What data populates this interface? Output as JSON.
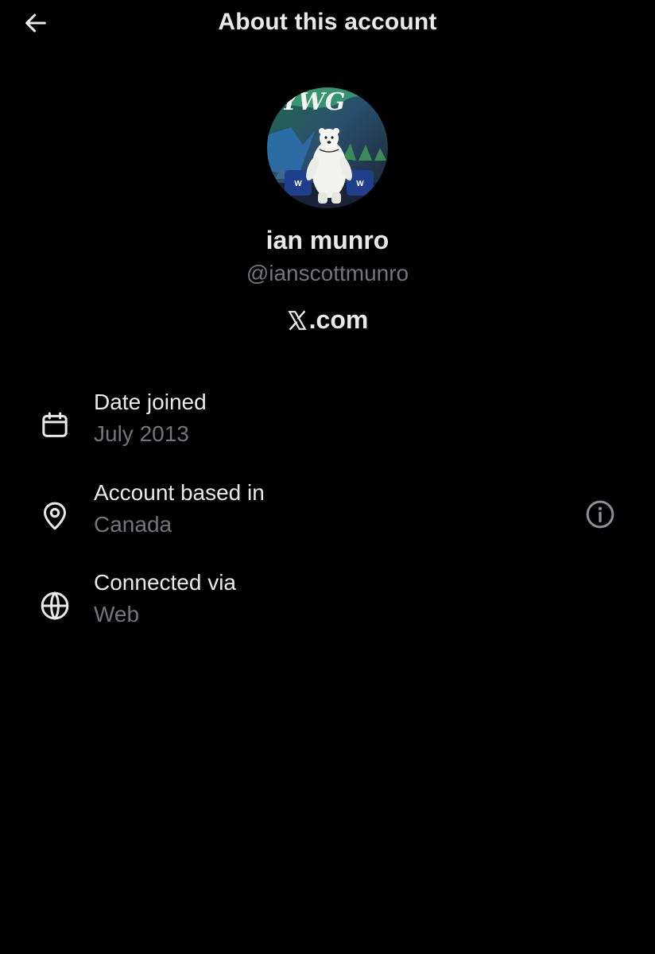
{
  "header": {
    "title": "About this account",
    "back_icon": "arrow-left-icon"
  },
  "profile": {
    "name": "ian munro",
    "handle": "@ianscottmunro",
    "platform_suffix": ".com",
    "platform_logo_icon": "x-logo-icon",
    "avatar_text": "YWG"
  },
  "details": [
    {
      "icon": "calendar-icon",
      "label": "Date joined",
      "value": "July 2013"
    },
    {
      "icon": "location-pin-icon",
      "label": "Account based in",
      "value": "Canada",
      "action_icon": "info-icon"
    },
    {
      "icon": "globe-icon",
      "label": "Connected via",
      "value": "Web"
    }
  ],
  "colors": {
    "background": "#000000",
    "primary_text": "#e7e9ea",
    "secondary_text": "#71767b"
  }
}
